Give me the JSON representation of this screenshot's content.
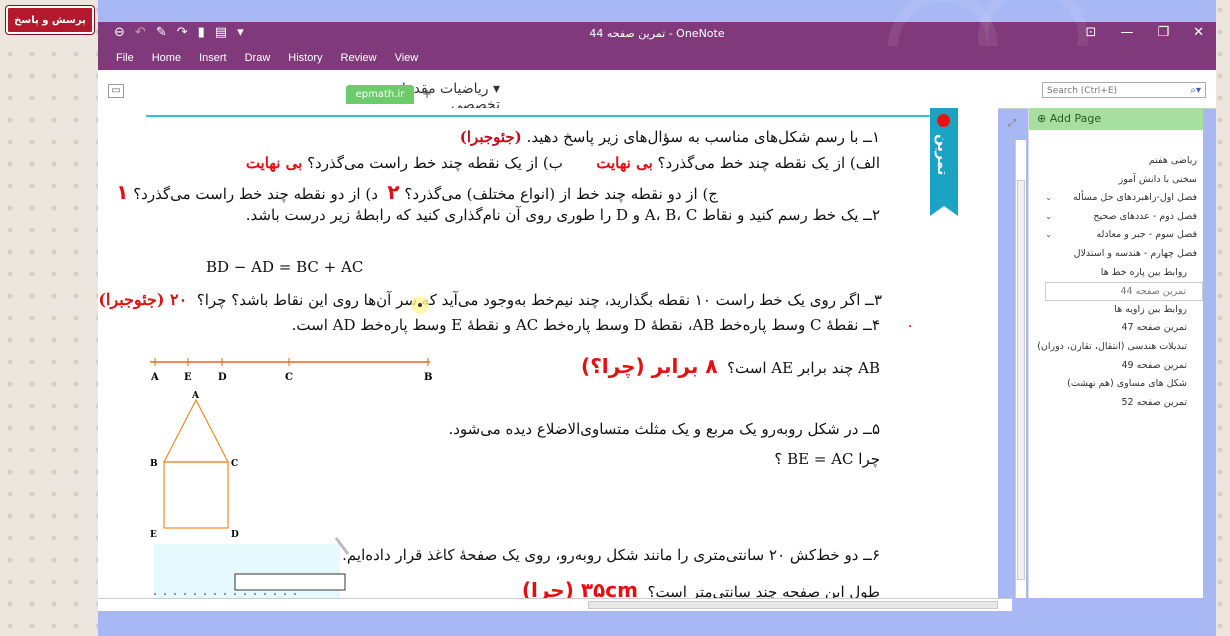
{
  "qa_button": "پرسش و پاسخ",
  "window": {
    "title": "تمرین صفحه 44  -  OneNote",
    "controls": [
      "⊡",
      "—",
      "❐",
      "✕"
    ]
  },
  "menu": [
    "File",
    "Home",
    "Insert",
    "Draw",
    "History",
    "Review",
    "View"
  ],
  "notebook": {
    "name": "ریاضیات مقدماتی و تخصصی",
    "section_tab": "epmath.ir",
    "add_tab": "+",
    "search_placeholder": "Search (Ctrl+E)"
  },
  "ribbon_label": "تمرین",
  "content": {
    "q1": "۱ــ با رسم شکل‌های مناسب به سؤال‌های زیر پاسخ دهید.",
    "q1_note": "(جئوجبرا)",
    "q1a": "الف) از یک نقطه چند خط می‌گذرد؟",
    "q1a_ans": "بی نهایت",
    "q1b": "ب) از یک نقطه چند خط راست می‌گذرد؟",
    "q1b_ans": "بی نهایت",
    "q1c": "ج) از دو نقطه چند خط از (انواع مختلف) می‌گذرد؟",
    "q1c_ans": "۲",
    "q1d": "د) از دو نقطه چند خط راست می‌گذرد؟",
    "q1d_ans": "۱",
    "q2": "۲ــ یک خط رسم کنید و نقاط A، B، C و D را طوری روی آن نام‌گذاری کنید که رابطهٔ زیر درست باشد.",
    "formula": "BD − AD = BC + AC",
    "q3": "۳ــ اگر روی یک خط راست ۱۰ نقطه بگذارید، چند نیم‌خط به‌وجود می‌آید که سر آن‌ها روی این نقاط باشد؟ چرا؟",
    "q3_ans": "۲۰ (جئوجبرا)",
    "q4": "۴ــ نقطهٔ C وسط پاره‌خط AB، نقطهٔ D وسط پاره‌خط AC و نقطهٔ E وسط پاره‌خط AD است.",
    "q4b": "AB چند برابر AE است؟",
    "q4_ans": "۸ برابر (چرا؟)",
    "q5": "۵ــ در شکل روبه‌رو یک مربع و یک مثلث متساوی‌الاضلاع دیده می‌شود.",
    "q5b": "چرا BE = AC ؟",
    "q6": "۶ــ دو خط‌کش ۲۰ سانتی‌متری را مانند شکل روبه‌رو، روی یک صفحهٔ کاغذ قرار داده‌ایم.",
    "q6b": "طول این صفحه چند سانتی‌متر است؟",
    "q6_ans": "۳۵cm (چرا)"
  },
  "line_labels": [
    "A",
    "E",
    "D",
    "C",
    "B"
  ],
  "house_labels": [
    "A",
    "B",
    "C",
    "E",
    "D"
  ],
  "pages": {
    "add_page": "Add Page",
    "items": [
      {
        "label": "ریاضی هفتم",
        "type": "page"
      },
      {
        "label": "سخنی با دانش آموز",
        "type": "page"
      },
      {
        "label": "فصل اول-راهبردهای حل مسأله",
        "type": "group"
      },
      {
        "label": "فصل دوم - عددهای صحیح",
        "type": "group"
      },
      {
        "label": "فصل سوم - جبر و معادله",
        "type": "group"
      },
      {
        "label": "فصل چهارم - هندسه و استدلال",
        "type": "page"
      },
      {
        "label": "روابط بین پاره خط ها",
        "type": "sub"
      },
      {
        "label": "تمرین صفحه 44",
        "type": "selected"
      },
      {
        "label": "روابط بین زاویه ها",
        "type": "sub"
      },
      {
        "label": "تمرین صفحه 47",
        "type": "sub"
      },
      {
        "label": "تبدیلات هندسی (انتقال، تقارن، دوران)",
        "type": "sub"
      },
      {
        "label": "تمرین صفحه 49",
        "type": "sub"
      },
      {
        "label": "شکل های مساوی (هم نهشت)",
        "type": "sub"
      },
      {
        "label": "تمرین صفحه 52",
        "type": "sub"
      }
    ]
  },
  "colors": {
    "title_bar": "#80397b",
    "section_tab": "#6ccb6a",
    "frame": "#a8b8f4",
    "answer_red": "#e21010",
    "ribbon": "#1aa3c2"
  }
}
